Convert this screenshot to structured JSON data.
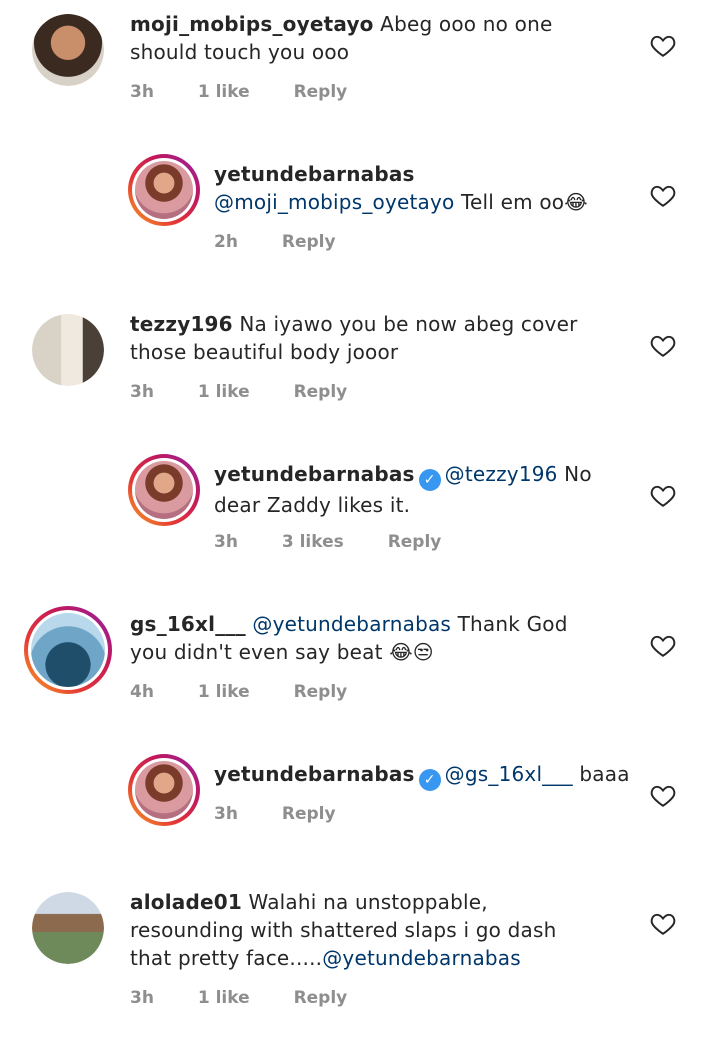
{
  "comments": [
    {
      "user": "moji_mobips_oyetayo",
      "text": " Abeg ooo no one should touch you ooo",
      "time": "3h",
      "likes": "1 like",
      "reply": "Reply"
    },
    {
      "user": "yetundebarnabas",
      "mention": "@moji_mobips_oyetayo",
      "text": " Tell em oo😂",
      "time": "2h",
      "reply": "Reply"
    },
    {
      "user": "tezzy196",
      "text": " Na iyawo you be now abeg cover those beautiful body jooor",
      "time": "3h",
      "likes": "1 like",
      "reply": "Reply"
    },
    {
      "user": "yetundebarnabas",
      "mention": "@tezzy196",
      "text": " No dear Zaddy likes it.",
      "time": "3h",
      "likes": "3 likes",
      "reply": "Reply"
    },
    {
      "user": "gs_16xl___",
      "mention": "@yetundebarnabas",
      "text": " Thank God you didn't even say beat 😂😒",
      "time": "4h",
      "likes": "1 like",
      "reply": "Reply"
    },
    {
      "user": "yetundebarnabas",
      "mention": "@gs_16xl___",
      "text": " baaa",
      "time": "3h",
      "reply": "Reply"
    },
    {
      "user": "alolade01",
      "text": " Walahi na unstoppable, resounding with shattered slaps i go dash that pretty face.....",
      "mention": "@yetundebarnabas",
      "time": "3h",
      "likes": "1 like",
      "reply": "Reply"
    }
  ],
  "icons": {
    "like": "heart-outline-icon",
    "verified": "verified-badge-icon"
  },
  "colors": {
    "mention": "#00376b",
    "meta": "#8e8e8e",
    "verified": "#3897f0"
  }
}
